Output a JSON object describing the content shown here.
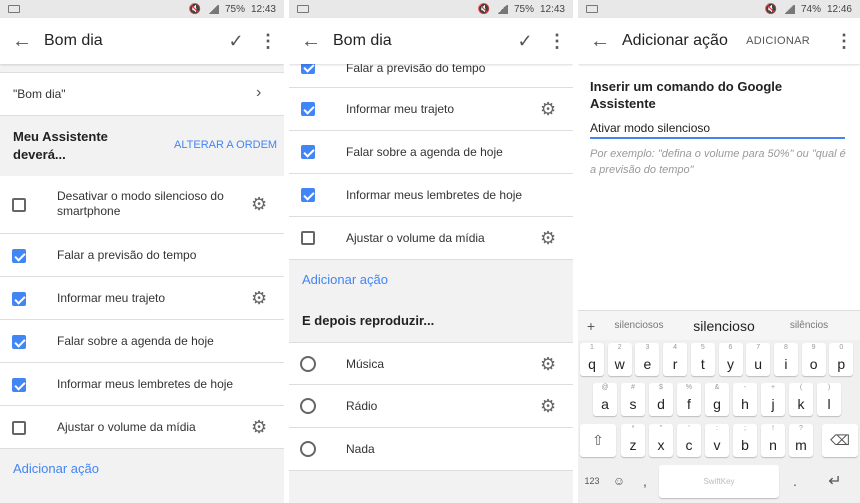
{
  "p1": {
    "status": {
      "battery": "75%",
      "time": "12:43"
    },
    "title": "Bom dia",
    "phrase": "\"Bom dia\"",
    "assist_heading": "Meu Assistente deverá...",
    "reorder": "ALTERAR A ORDEM",
    "actions": [
      {
        "label": "Desativar o modo silencioso do smartphone",
        "checked": false,
        "gear": true
      },
      {
        "label": "Falar a previsão do tempo",
        "checked": true,
        "gear": false
      },
      {
        "label": "Informar meu trajeto",
        "checked": true,
        "gear": true
      },
      {
        "label": "Falar sobre a agenda de hoje",
        "checked": true,
        "gear": false
      },
      {
        "label": "Informar meus lembretes de hoje",
        "checked": true,
        "gear": false
      },
      {
        "label": "Ajustar o volume da mídia",
        "checked": false,
        "gear": true
      }
    ],
    "add_action": "Adicionar ação"
  },
  "p2": {
    "status": {
      "battery": "75%",
      "time": "12:43"
    },
    "title": "Bom dia",
    "actions": [
      {
        "label": "Falar a previsão do tempo",
        "checked": true,
        "gear": false
      },
      {
        "label": "Informar meu trajeto",
        "checked": true,
        "gear": true
      },
      {
        "label": "Falar sobre a agenda de hoje",
        "checked": true,
        "gear": false
      },
      {
        "label": "Informar meus lembretes de hoje",
        "checked": true,
        "gear": false
      },
      {
        "label": "Ajustar o volume da mídia",
        "checked": false,
        "gear": true
      }
    ],
    "add_action": "Adicionar ação",
    "then_play": "E depois reproduzir...",
    "media": [
      {
        "label": "Música",
        "gear": true
      },
      {
        "label": "Rádio",
        "gear": true
      },
      {
        "label": "Nada",
        "gear": false
      }
    ]
  },
  "p3": {
    "status": {
      "battery": "74%",
      "time": "12:46"
    },
    "title": "Adicionar ação",
    "add_button": "ADICIONAR",
    "prompt": "Inserir um comando do Google Assistente",
    "input_value": "Ativar modo silencioso",
    "hint": "Por exemplo: \"defina o volume para 50%\" ou \"qual é a previsão do tempo\"",
    "suggestions": [
      "silenciosos",
      "silencioso",
      "silêncios"
    ],
    "keyboard": {
      "row1": [
        [
          "1",
          "q"
        ],
        [
          "2",
          "w"
        ],
        [
          "3",
          "e"
        ],
        [
          "4",
          "r"
        ],
        [
          "5",
          "t"
        ],
        [
          "6",
          "y"
        ],
        [
          "7",
          "u"
        ],
        [
          "8",
          "i"
        ],
        [
          "9",
          "o"
        ],
        [
          "0",
          "p"
        ]
      ],
      "row2": [
        [
          "@",
          "a"
        ],
        [
          "#",
          "s"
        ],
        [
          "$",
          "d"
        ],
        [
          "%",
          "f"
        ],
        [
          "&",
          "g"
        ],
        [
          "-",
          "h"
        ],
        [
          "+",
          "j"
        ],
        [
          "(",
          "k"
        ],
        [
          ")",
          "l"
        ]
      ],
      "row3": [
        [
          "*",
          "z"
        ],
        [
          "\"",
          "x"
        ],
        [
          "'",
          "c"
        ],
        [
          ":",
          "v"
        ],
        [
          ";",
          "b"
        ],
        [
          "!",
          "n"
        ],
        [
          "?",
          "m"
        ]
      ],
      "numbers_key": "123",
      "brand": "SwiftKey"
    }
  }
}
